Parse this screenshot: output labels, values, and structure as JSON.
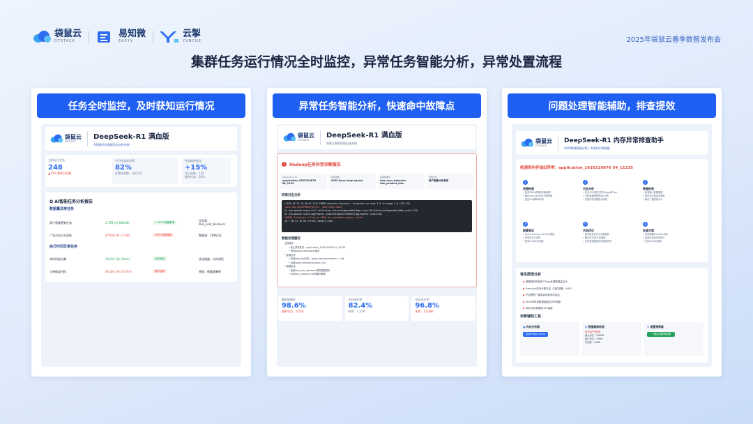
{
  "header": {
    "logos": [
      {
        "main": "袋鼠云",
        "sub": "DTSTACK"
      },
      {
        "main": "易知微",
        "sub": "EASYV"
      },
      {
        "main": "云掣",
        "sub": "YUNCHE"
      }
    ],
    "event": "2025年袋鼠云春季数智发布会"
  },
  "headline": "集群任务运行情况全时监控，异常任务智能分析，异常处置流程",
  "colors": {
    "accent": "#1f5ff2",
    "danger": "#e0483c",
    "success": "#22a35a"
  },
  "panels": [
    {
      "title": "任务全时监控，及时获知运行情况",
      "screen": {
        "logo_main": "袋鼠云",
        "logo_sub": "DTSTACK",
        "app_title": "DeepSeek-R1 满血版",
        "app_sub": "AI智能的大数据任务分析系统",
        "stats": [
          {
            "label": "当前运行任务",
            "value": "248",
            "note": "▲12% 较昨日同期"
          },
          {
            "label": "今日任务成功率",
            "value": "82%",
            "note": "异常任务数：36/314"
          },
          {
            "label": "任务耗时变化",
            "value": "+15%",
            "note": "今日总耗：12h\n超时任务：28%"
          }
        ],
        "report_title": "Q AI智能任务分析报告",
        "section1": "数据量异常任务",
        "rows1": [
          {
            "name": "用户画像更新任务",
            "value": "2.1TB (约 680GB)",
            "status": "+140% 数据激增",
            "detail": "涉及表：\ndws_user_behavior"
          },
          {
            "name": "广告点击日志清洗",
            "value": "470GB (约 1.1GB)",
            "status": "-99% 数据骤降",
            "detail": "数据源：CDN日志"
          }
        ],
        "section2": "执行时间异常任务",
        "rows2": [
          {
            "name": "实时风控计算",
            "value": "1h03m (约 20min)",
            "status": "延迟增加",
            "detail": "优化措施：内存调优"
          },
          {
            "name": "订单维度归档",
            "value": "4h18m (约 2h47m)",
            "status": "超时告警",
            "detail": "原因：数据量暴增"
          }
        ]
      }
    },
    {
      "title": "异常任务智能分析，快速命中故障点",
      "screen": {
        "logo_main": "袋鼠云",
        "logo_sub": "DTSTACK",
        "app_title": "DeepSeek-R1 满血版",
        "app_sub": "智能大数据智能运维系统",
        "alert_title": "Hadoop任务异常诊断报告",
        "fields": [
          {
            "label": "Application ID",
            "value": "application_1635219876 54_1123"
          },
          {
            "label": "错误类型",
            "value": "OOM (Java heap space)"
          },
          {
            "label": "关联数据表",
            "value": "dws_user_behavior\ndim_product_info"
          },
          {
            "label": "所属业务",
            "value": "用户画像分析系统"
          }
        ],
        "log_title": "异常日志分析",
        "log_lines": [
          "[2025-10-15 14:28:43,123] ERROR executor.Executor: Exception in task 3.0 in stage 2.0 (TID 45)",
          "java.lang.OutOfMemoryError: Java heap space",
          "    at org.apache.spark.util.collection.ExternalAppendOnlyMap.insertAll(ExternalAppendOnlyMap.scala:153)",
          "    at org.apache.spark.Aggregator.combineCombinersByKey(Aggregator.scala:58)",
          "[WARN] Container killed by YARN for exceeding memory limits",
          "16.7 GB of 16 GB virtual memory used"
        ],
        "suggest_title": "智能处理建议",
        "suggestions": [
          "立即操作：",
          "• 终止异常任务：application_1635219876 54_11235",
          "• 重启ResourceManager服务",
          "• 配置优化：",
          "• 增加executor内存：spark.executor.memory → 8g",
          "• 设置spark.memory.fraction=0.6",
          "• 数据优化：",
          "• 检查dws_user_behavior表的数据倾斜",
          "• 优化dim_product_info的缓存策略"
        ],
        "stats": [
          {
            "label": "集群健康度",
            "value": "98.6%",
            "note": "故障节点：2/150"
          },
          {
            "label": "内存使用率",
            "value": "82.4%",
            "note": "剩余：1.2TB"
          },
          {
            "label": "任务成功率",
            "value": "96.8%",
            "note": "失败：12/380"
          }
        ]
      }
    },
    {
      "title": "问题处理智能辅助，排查提效",
      "screen": {
        "logo_main": "袋鼠云",
        "logo_sub": "DTSTACK",
        "app_title": "DeepSeek-R1 内存异常排查助手",
        "app_sub": "OOM故障智能诊断 | 专家知识库赋能",
        "detected": "检测到内存溢出异常：application_1635219876 54_11235",
        "steps": [
          {
            "n": "1",
            "title": "资源检查",
            "lines": [
              "• 检查YARN资源队列使用率",
              "• 确认Executor内存分配配置",
              "• 监控GC频率和时间"
            ]
          },
          {
            "n": "2",
            "title": "日志分析",
            "lines": [
              "• 定位OOM发生时的Stage和Task",
              "• 分析数据倾斜的Key分布",
              "• 识别内存泄漏的代码段"
            ]
          },
          {
            "n": "3",
            "title": "数据检查",
            "lines": [
              "• 检测输入数据规模",
              "• 验证分区数量合理性",
              "• 确认广播变量大小"
            ]
          },
          {
            "n": "4",
            "title": "配置验证",
            "lines": [
              "• spark.memory.fraction配置",
              "• 序列化方式选择",
              "• 检查shuffle分区数"
            ]
          },
          {
            "n": "5",
            "title": "代码优化",
            "lines": [
              "• 检查是否存在大对象缓存",
              "• 确认RDD持久化级别",
              "• 分析宽依赖操作的使用情况"
            ]
          },
          {
            "n": "6",
            "title": "处理方案",
            "lines": [
              "• 动态调整Executor内存",
              "• 启用自适应查询执行",
              "• 优化Shuffle参数"
            ]
          }
        ],
        "causes_title": "常见原因分析",
        "causes": [
          "数据倾斜导致单个Task处理数据量过大",
          "Executor内存分配不足（当前设置：4GB）",
          "不合理的广播变量导致内存溢出",
          "Shuffle阶段数据量超过内存限制",
          "存在内存泄漏的UDF函数"
        ],
        "tools_title": "诊断辅助工具",
        "tools": [
          {
            "title": "内存分析器",
            "button": "启动Heap Dump",
            "lines": []
          },
          {
            "title": "数据倾斜检测",
            "button": "",
            "lines": [
              "检测到严重倾斜",
              "最大分区：128MB",
              "最小分区：32MB",
              "中位数：45MB"
            ]
          },
          {
            "title": "配置推荐器",
            "button": "一键应用推荐配置",
            "lines": []
          }
        ]
      }
    }
  ]
}
